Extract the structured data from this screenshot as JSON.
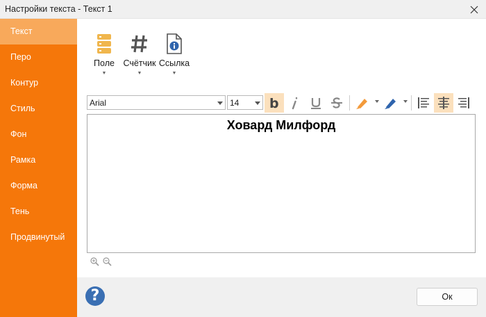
{
  "window": {
    "title": "Настройки текста - Текст 1"
  },
  "sidebar": {
    "items": [
      {
        "label": "Текст",
        "active": true
      },
      {
        "label": "Перо"
      },
      {
        "label": "Контур"
      },
      {
        "label": "Стиль"
      },
      {
        "label": "Фон"
      },
      {
        "label": "Рамка"
      },
      {
        "label": "Форма"
      },
      {
        "label": "Тень"
      },
      {
        "label": "Продвинутый"
      }
    ]
  },
  "toolbar": {
    "field_label": "Поле",
    "counter_label": "Счётчик",
    "link_label": "Ссылка",
    "font_name": "Arial",
    "font_size": "14"
  },
  "editor": {
    "text": "Ховард Милфорд"
  },
  "footer": {
    "help_symbol": "?",
    "ok_label": "Ок"
  },
  "colors": {
    "sidebar": "#f5770a",
    "sidebar_active": "#f8a95b",
    "toggle_on": "#fbe0bd",
    "help": "#3a6fb3"
  }
}
